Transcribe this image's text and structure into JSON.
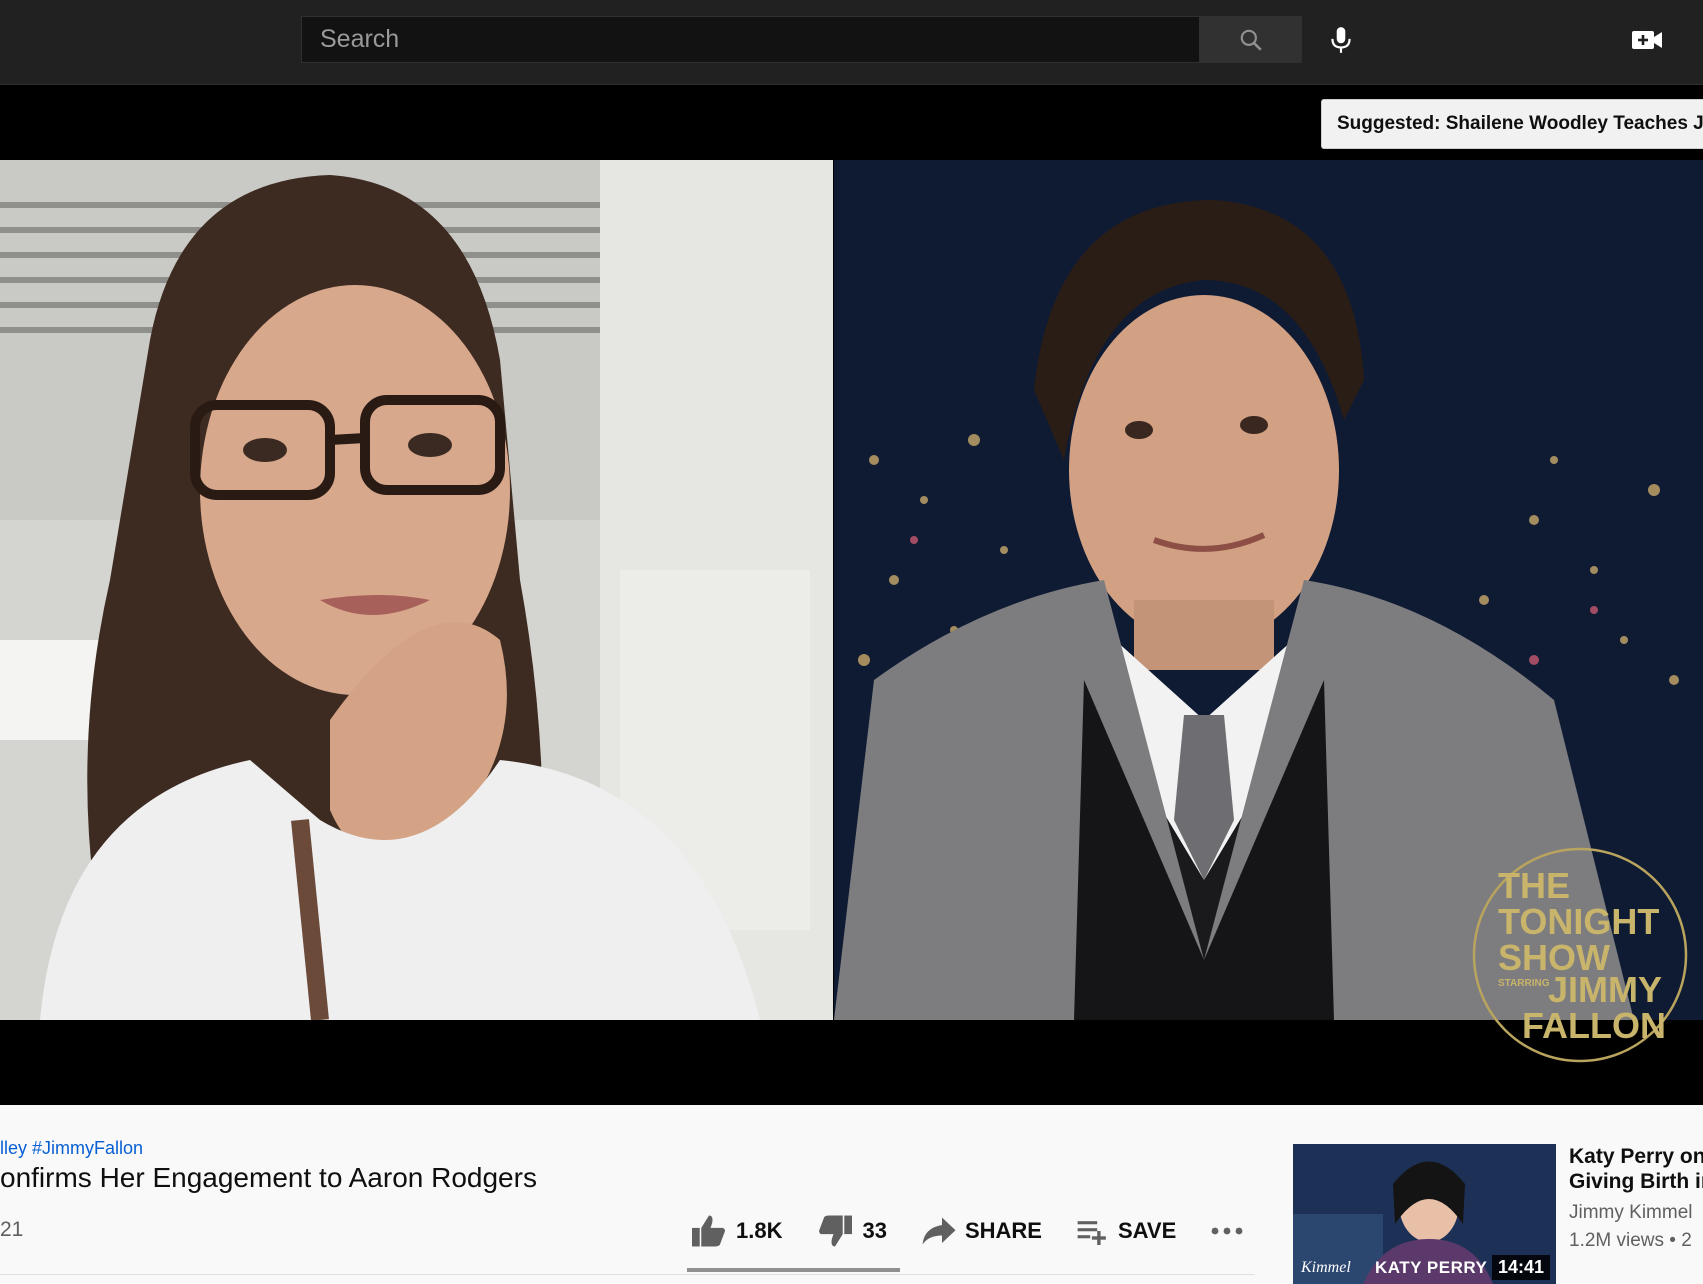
{
  "search": {
    "placeholder": "Search"
  },
  "player": {
    "suggested_card": "Suggested: Shailene Woodley Teaches Jimmy"
  },
  "video": {
    "hashtags": "lley #JimmyFallon",
    "title": "onfirms Her Engagement to Aaron Rodgers",
    "date_fragment": "21",
    "actions": {
      "likes": "1.8K",
      "dislikes": "33",
      "share_label": "SHARE",
      "save_label": "SAVE"
    },
    "like_ratio_percent": 98
  },
  "recommendation": {
    "title_line1": "Katy Perry on",
    "title_line2": "Giving Birth in",
    "channel": "Jimmy Kimmel",
    "meta": "1.2M views • 2",
    "duration": "14:41",
    "thumb_text": "KATY PERRY"
  },
  "colors": {
    "topbar": "#212121",
    "link": "#065fd4",
    "text": "#0f0f0f",
    "secondary_text": "#606060"
  }
}
